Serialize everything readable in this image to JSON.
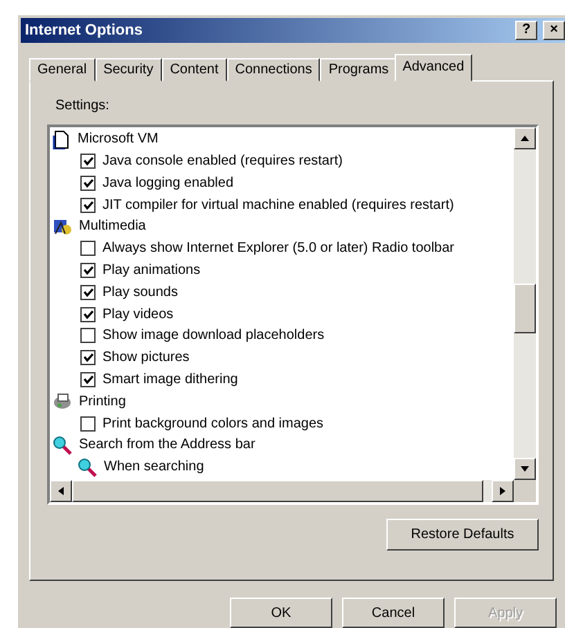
{
  "window": {
    "title": "Internet Options",
    "help_button": "?",
    "close_button": "×"
  },
  "tabs": [
    {
      "label": "General",
      "selected": false
    },
    {
      "label": "Security",
      "selected": false
    },
    {
      "label": "Content",
      "selected": false
    },
    {
      "label": "Connections",
      "selected": false
    },
    {
      "label": "Programs",
      "selected": false
    },
    {
      "label": "Advanced",
      "selected": true
    }
  ],
  "settings_label": "Settings:",
  "settings": [
    {
      "kind": "category",
      "label": "Microsoft VM"
    },
    {
      "kind": "checkbox",
      "label": "Java console enabled (requires restart)",
      "checked": true
    },
    {
      "kind": "checkbox",
      "label": "Java logging enabled",
      "checked": true
    },
    {
      "kind": "checkbox",
      "label": "JIT compiler for virtual machine enabled (requires restart)",
      "checked": true
    },
    {
      "kind": "category",
      "label": "Multimedia"
    },
    {
      "kind": "checkbox",
      "label": "Always show Internet Explorer (5.0 or later) Radio toolbar",
      "checked": false
    },
    {
      "kind": "checkbox",
      "label": "Play animations",
      "checked": true
    },
    {
      "kind": "checkbox",
      "label": "Play sounds",
      "checked": true
    },
    {
      "kind": "checkbox",
      "label": "Play videos",
      "checked": true
    },
    {
      "kind": "checkbox",
      "label": "Show image download placeholders",
      "checked": false
    },
    {
      "kind": "checkbox",
      "label": "Show pictures",
      "checked": true
    },
    {
      "kind": "checkbox",
      "label": "Smart image dithering",
      "checked": true
    },
    {
      "kind": "category",
      "label": "Printing"
    },
    {
      "kind": "checkbox",
      "label": "Print background colors and images",
      "checked": false
    },
    {
      "kind": "category",
      "label": "Search from the Address bar"
    },
    {
      "kind": "subcategory",
      "label": "When searching"
    }
  ],
  "restore_button": "Restore Defaults",
  "buttons": [
    {
      "label": "OK",
      "disabled": false
    },
    {
      "label": "Cancel",
      "disabled": false
    },
    {
      "label": "Apply",
      "disabled": true
    }
  ]
}
